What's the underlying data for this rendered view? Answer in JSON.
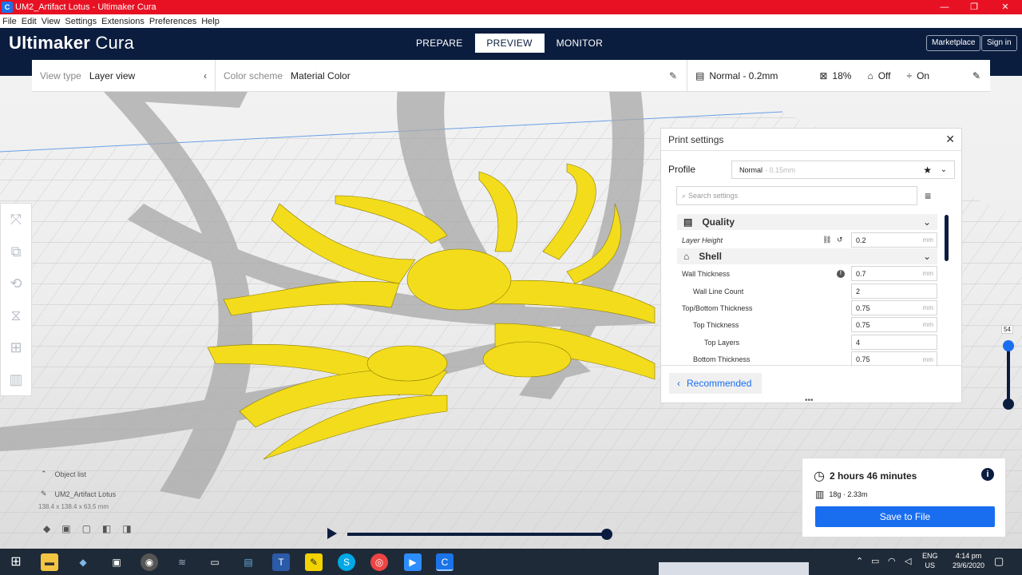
{
  "window": {
    "title": "UM2_Artifact Lotus - Ultimaker Cura",
    "app_icon": "C"
  },
  "menu": [
    "File",
    "Edit",
    "View",
    "Settings",
    "Extensions",
    "Preferences",
    "Help"
  ],
  "header": {
    "logo_main": "Ultimaker",
    "logo_sub": "Cura",
    "stages": [
      "PREPARE",
      "PREVIEW",
      "MONITOR"
    ],
    "active_stage": "PREVIEW",
    "marketplace": "Marketplace",
    "signin": "Sign in"
  },
  "toolbar": {
    "view_type_label": "View type",
    "view_type_value": "Layer view",
    "color_scheme_label": "Color scheme",
    "color_scheme_value": "Material Color",
    "profile": "Normal - 0.2mm",
    "infill": "18%",
    "support": "Off",
    "adhesion": "On"
  },
  "print_settings": {
    "title": "Print settings",
    "profile_label": "Profile",
    "profile_value": "Normal",
    "profile_suffix": "- 0.15mm",
    "search_placeholder": "Search settings",
    "categories": {
      "quality": "Quality",
      "shell": "Shell"
    },
    "settings": {
      "layer_height": {
        "label": "Layer Height",
        "value": "0.2",
        "unit": "mm"
      },
      "wall_thickness": {
        "label": "Wall Thickness",
        "value": "0.7",
        "unit": "mm"
      },
      "wall_line_count": {
        "label": "Wall Line Count",
        "value": "2"
      },
      "topbottom_thickness": {
        "label": "Top/Bottom Thickness",
        "value": "0.75",
        "unit": "mm"
      },
      "top_thickness": {
        "label": "Top Thickness",
        "value": "0.75",
        "unit": "mm"
      },
      "top_layers": {
        "label": "Top Layers",
        "value": "4"
      },
      "bottom_thickness": {
        "label": "Bottom Thickness",
        "value": "0.75",
        "unit": "mm"
      }
    },
    "recommended": "Recommended"
  },
  "layer_slider": {
    "value": "54"
  },
  "object": {
    "list_label": "Object list",
    "name": "UM2_Artifact Lotus",
    "dims": "138.4 x 138.4 x 63.5 mm"
  },
  "estimate": {
    "time": "2 hours 46 minutes",
    "material": "18g · 2.33m",
    "save": "Save to File"
  },
  "taskbar": {
    "lang1": "ENG",
    "lang2": "US",
    "time": "4:14 pm",
    "date": "29/6/2020"
  },
  "colors": {
    "header": "#0b1d3f",
    "accent": "#196ef0",
    "titlebar": "#e81123",
    "model": "#f3dc1b"
  }
}
